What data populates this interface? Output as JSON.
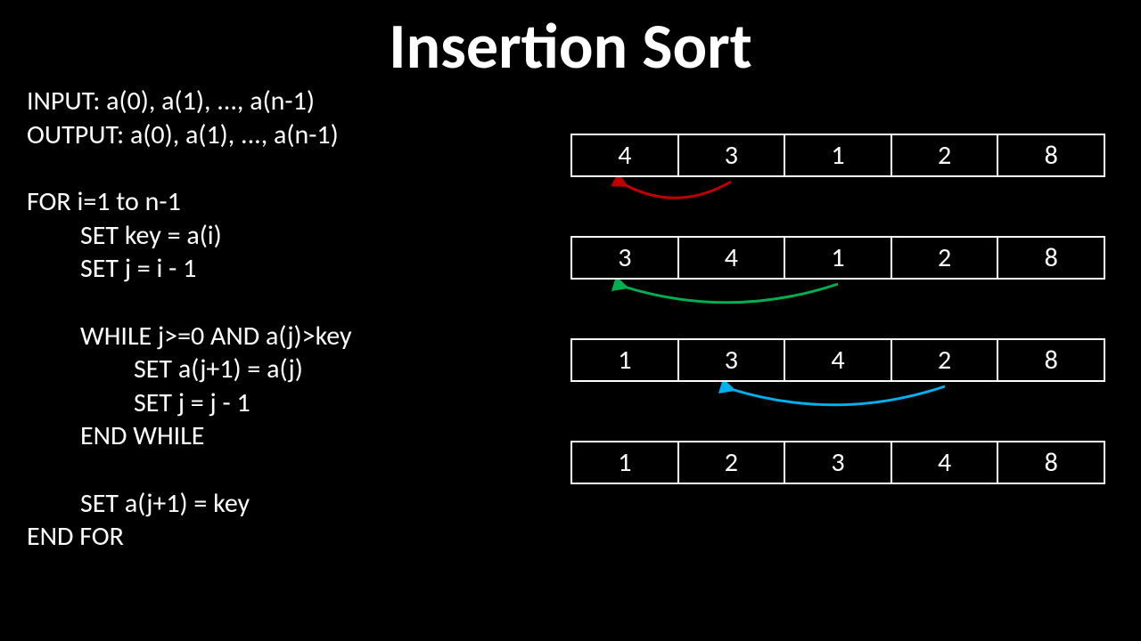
{
  "title": "Insertion Sort",
  "pseudocode": {
    "l1": "INPUT: a(0), a(1), ..., a(n-1)",
    "l2": "OUTPUT: a(0), a(1), ..., a(n-1)",
    "l3": "FOR i=1 to n-1",
    "l4": "SET key = a(i)",
    "l5": "SET j = i - 1",
    "l6": "WHILE j>=0 AND a(j)>key",
    "l7": "SET a(j+1) = a(j)",
    "l8": "SET j = j - 1",
    "l9": "END WHILE",
    "l10": "SET a(j+1) = key",
    "l11": "END FOR"
  },
  "arrays": {
    "step1": [
      "4",
      "3",
      "1",
      "2",
      "8"
    ],
    "step2": [
      "3",
      "4",
      "1",
      "2",
      "8"
    ],
    "step3": [
      "1",
      "3",
      "4",
      "2",
      "8"
    ],
    "step4": [
      "1",
      "2",
      "3",
      "4",
      "8"
    ]
  },
  "arrows": {
    "step1_color": "#C00000",
    "step2_color": "#00B050",
    "step3_color": "#00B0F0"
  }
}
